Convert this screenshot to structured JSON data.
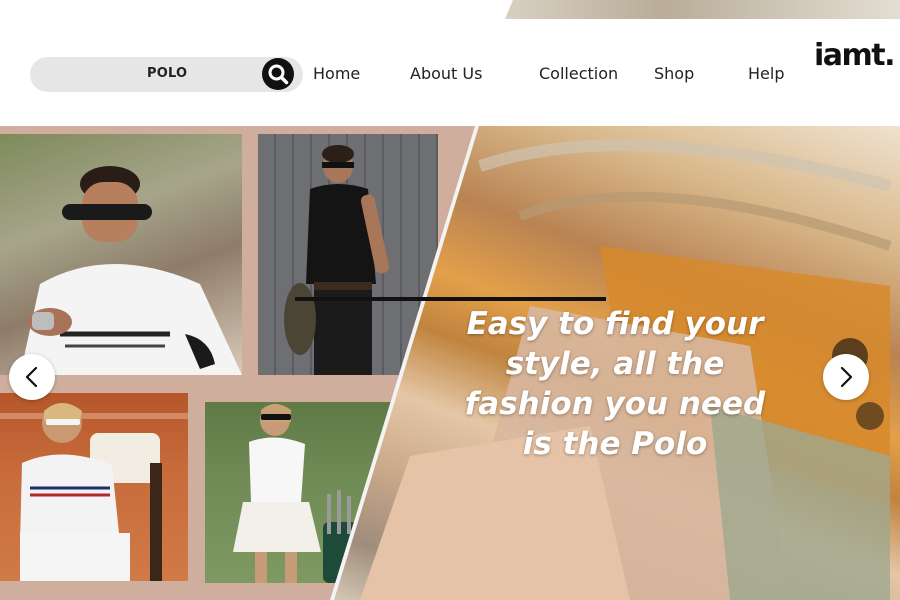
{
  "search": {
    "value": "POLO"
  },
  "nav": {
    "items": [
      {
        "label": "Home"
      },
      {
        "label": "About Us"
      },
      {
        "label": "Collection"
      },
      {
        "label": "Shop"
      },
      {
        "label": "Help"
      }
    ]
  },
  "brand": {
    "logo_text": "iamt."
  },
  "hero": {
    "headline": "Easy to find your style, all the fashion you need is the Polo",
    "prev_icon": "chevron-left-icon",
    "next_icon": "chevron-right-icon"
  },
  "icons": {
    "search": "search-icon"
  },
  "colors": {
    "accent_dark": "#111111",
    "search_bg": "#e6e6e6",
    "hero_bg": "#cfae9d",
    "headline": "#ffffff"
  }
}
